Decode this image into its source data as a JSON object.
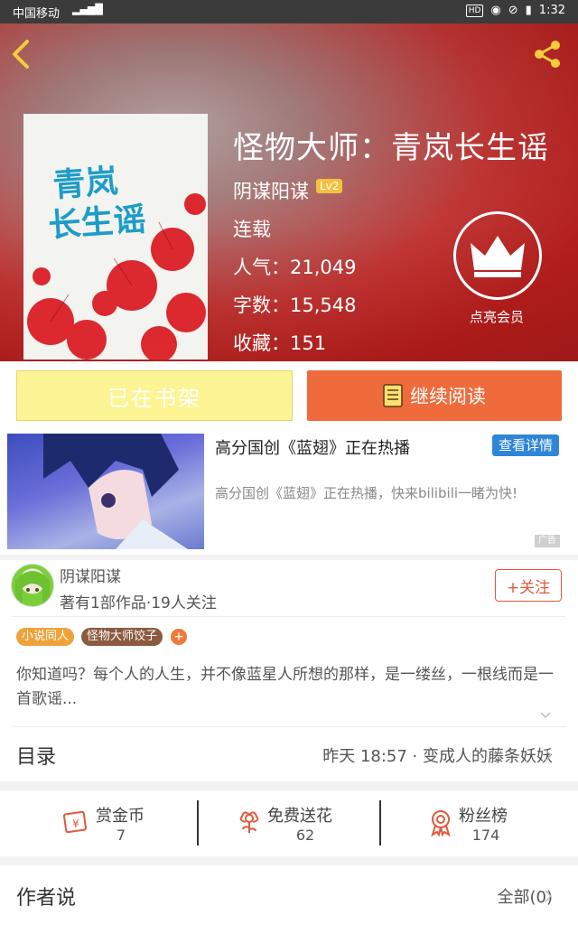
{
  "status_bar": {
    "carrier": "中国移动",
    "time": "1:32",
    "hd": "HD"
  },
  "book": {
    "title": "怪物大师：青岚长生谣",
    "author": "阴谋阳谋",
    "author_level": "Lv2",
    "status": "连载",
    "popularity": "人气：21,049",
    "word_count": "字数：15,548",
    "favorites": "收藏：151",
    "cover_text_line1": "青岚",
    "cover_text_line2": "长生谣"
  },
  "vip": {
    "label": "点亮会员"
  },
  "actions": {
    "shelf_label": "已在书架",
    "read_label": "继续阅读"
  },
  "ad": {
    "title": "高分国创《蓝翅》正在热播",
    "detail_button": "查看详情",
    "description": "高分国创《蓝翅》正在热播，快来bilibili一睹为快!",
    "tag": "广告"
  },
  "author_block": {
    "name": "阴谋阳谋",
    "summary": "著有1部作品·19人关注",
    "follow_label": "+关注"
  },
  "tags": [
    "小说同人",
    "怪物大师饺子"
  ],
  "tag_add": "+",
  "description": "你知道吗？每个人的人生，并不像蓝星人所想的那样，是一缕丝，一根线而是一首歌谣...",
  "toc": {
    "label": "目录",
    "latest": "昨天 18:57 · 变成人的藤条妖妖"
  },
  "stats": [
    {
      "label": "赏金币",
      "value": "7",
      "icon": "coin-envelope-icon"
    },
    {
      "label": "免费送花",
      "value": "62",
      "icon": "flower-icon"
    },
    {
      "label": "粉丝榜",
      "value": "174",
      "icon": "medal-icon"
    }
  ],
  "author_says": {
    "label": "作者说",
    "all": "全部(0)"
  },
  "colors": {
    "accent_orange": "#ef6b3b",
    "shelf_yellow": "#fdf493",
    "hero_red": "#b3201e",
    "ad_blue": "#2f86d6"
  }
}
